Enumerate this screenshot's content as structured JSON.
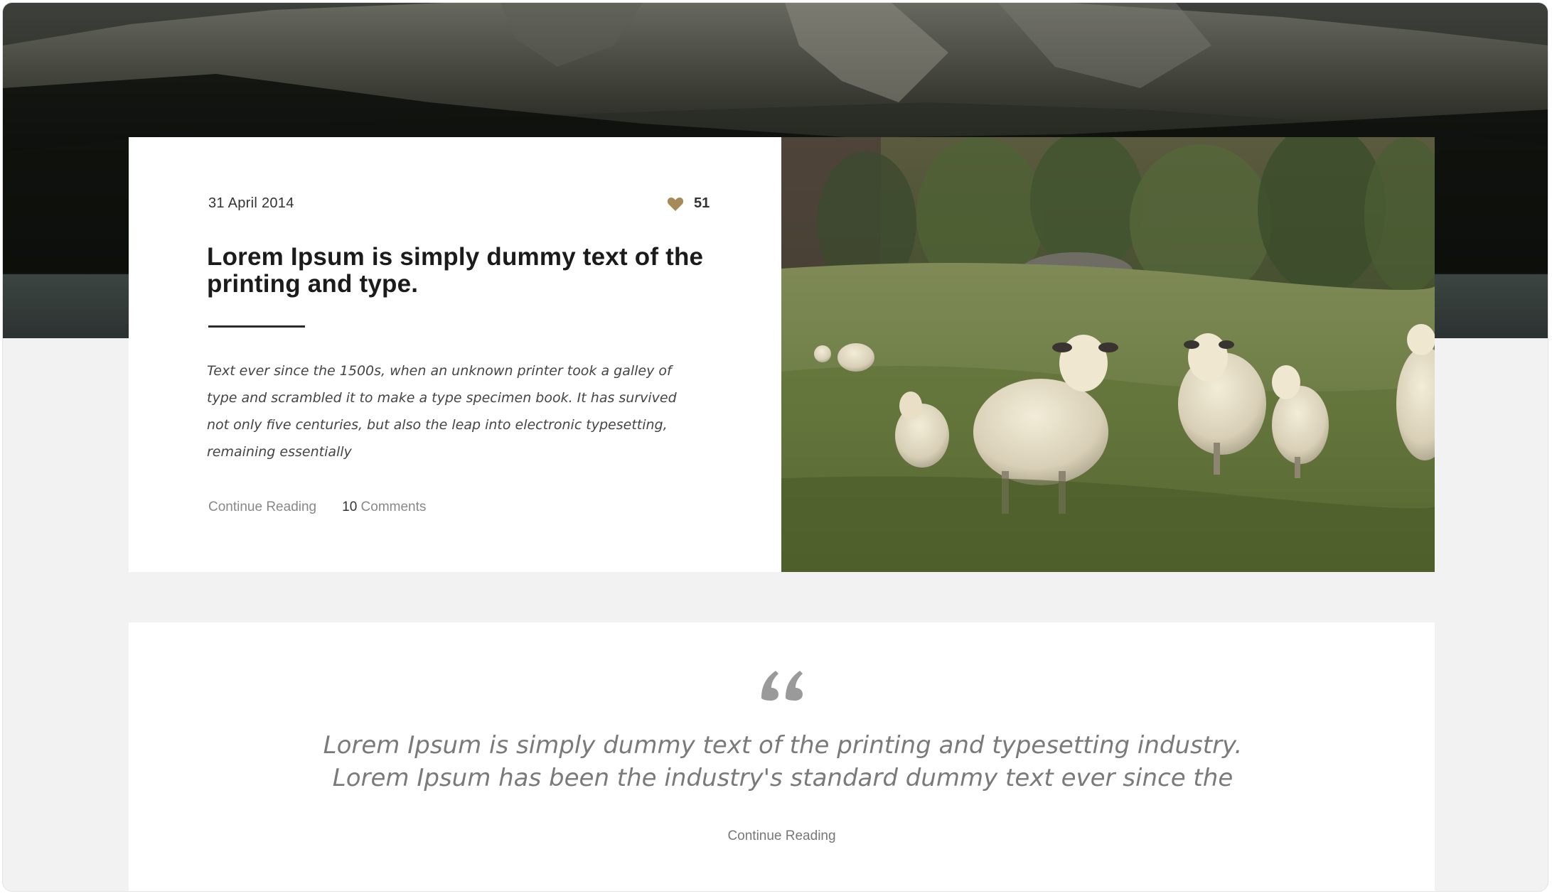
{
  "colors": {
    "page_background": "#f2f2f2",
    "card_background": "#ffffff",
    "title_text": "#1b1b1b",
    "muted_text": "#888888",
    "heart_accent": "#a88a5a"
  },
  "featured_post": {
    "date": "31 April 2014",
    "likes": {
      "icon": "heart-icon",
      "count": "51"
    },
    "title": "Lorem Ipsum is simply dummy text of the printing and type.",
    "excerpt": "Text ever since the 1500s, when an unknown printer took a galley of type and scrambled it to make a type specimen book. It has survived not only five centuries, but also the leap into electronic typesetting, remaining essentially",
    "continue_label": "Continue Reading",
    "comments_count": "10",
    "comments_label": "Comments"
  },
  "quote_post": {
    "icon": "quote-icon",
    "text": "Lorem Ipsum is simply dummy text of the printing and typesetting industry. Lorem Ipsum has been the industry's standard dummy text ever since the",
    "continue_label": "Continue Reading"
  }
}
